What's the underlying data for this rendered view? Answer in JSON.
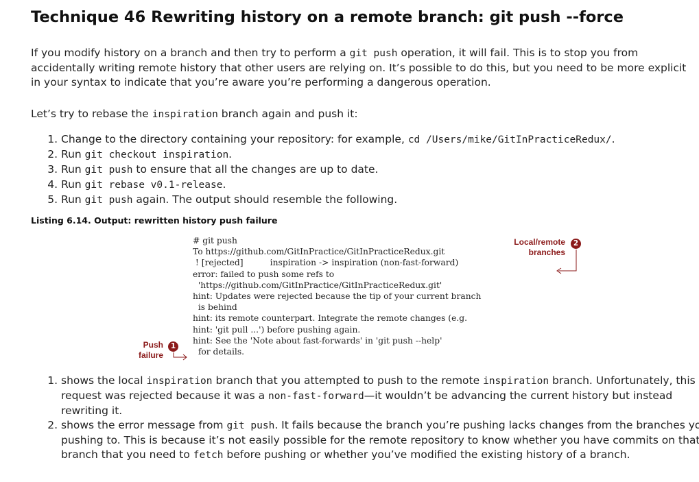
{
  "title": "Technique 46 Rewriting history on a remote branch: git push --force",
  "intro": {
    "t1": "If you modify history on a branch and then try to perform a ",
    "c1": "git push",
    "t2": " operation, it will fail. This is to stop you from accidentally writing remote history that other users are relying on. It’s possible to do this, but you need to be more explicit in your syntax to indicate that you’re aware you’re performing a dangerous operation."
  },
  "lead": {
    "t1": "Let’s try to rebase the ",
    "c1": "inspiration",
    "t2": " branch again and push it:"
  },
  "steps": [
    {
      "t1": "Change to the directory containing your repository: for example, ",
      "c1": "cd /Users/mike/GitInPracticeRedux/",
      "t2": "."
    },
    {
      "t1": "Run ",
      "c1": "git checkout inspiration",
      "t2": "."
    },
    {
      "t1": "Run ",
      "c1": "git push",
      "t2": " to ensure that all the changes are up to date."
    },
    {
      "t1": "Run ",
      "c1": "git rebase v0.1-release",
      "t2": "."
    },
    {
      "t1": "Run ",
      "c1": "git push",
      "t2": " again. The output should resemble the following."
    }
  ],
  "listing": {
    "caption": "Listing 6.14. Output: rewritten history push failure",
    "lines": [
      "# git push",
      "",
      "To https://github.com/GitInPractice/GitInPracticeRedux.git",
      " ! [rejected]          inspiration -> inspiration (non-fast-forward)",
      "error: failed to push some refs to",
      "  'https://github.com/GitInPractice/GitInPracticeRedux.git'",
      "hint: Updates were rejected because the tip of your current branch",
      "  is behind",
      "hint: its remote counterpart. Integrate the remote changes (e.g.",
      "hint: 'git pull ...') before pushing again.",
      "hint: See the 'Note about fast-forwards' in 'git push --help'",
      "  for details."
    ],
    "callouts": [
      {
        "line1": "Push",
        "line2": "failure",
        "number": "1"
      },
      {
        "line1": "Local/remote",
        "line2": "branches",
        "number": "2"
      }
    ],
    "callout_color": "#8b1a1a"
  },
  "notes": [
    {
      "t1": "shows the local ",
      "c1": "inspiration",
      "t2": " branch that you attempted to push to the remote ",
      "c2": "inspiration",
      "t3": " branch. Unfortunately, this request was rejected because it was a ",
      "c3": "non-fast-forward",
      "t4": "—it wouldn’t be advancing the current history but instead rewriting it."
    },
    {
      "t1": "shows the error message from ",
      "c1": "git push",
      "t2": ". It fails because the branch you’re pushing lacks changes from the branches you’re pushing to. This is because it’s not easily possible for the remote repository to know whether you have commits on that branch that you need to ",
      "c2": "fetch",
      "t3": " before pushing or whether you’ve modified the existing history of a branch."
    }
  ]
}
